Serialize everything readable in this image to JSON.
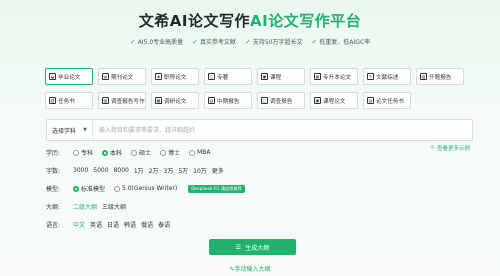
{
  "header": {
    "title_part1": "文希AI论文写作",
    "title_part2": "AI论文写作平台",
    "features": [
      "AI5.0专业高质量",
      "真实参考文献",
      "支持50万字超长文",
      "低重复、低AIGC率"
    ]
  },
  "paper_types": [
    {
      "label": "毕业论文",
      "icon": "graduation-cap-icon",
      "glyph": "◒",
      "active": true
    },
    {
      "label": "期刊论文",
      "icon": "journal-icon",
      "glyph": "▤",
      "active": false
    },
    {
      "label": "职称论文",
      "icon": "shield-icon",
      "glyph": "◈",
      "active": false
    },
    {
      "label": "专著",
      "icon": "book-icon",
      "glyph": "▯",
      "active": false
    },
    {
      "label": "课程",
      "icon": "course-icon",
      "glyph": "▣",
      "active": false
    },
    {
      "label": "专升本论文",
      "icon": "upgrade-icon",
      "glyph": "▦",
      "active": false
    },
    {
      "label": "文献综述",
      "icon": "review-icon",
      "glyph": "✎",
      "active": false
    },
    {
      "label": "开题报告",
      "icon": "report-icon",
      "glyph": "▥",
      "active": false
    },
    {
      "label": "任务书",
      "icon": "task-icon",
      "glyph": "▧",
      "active": false
    },
    {
      "label": "调查报告写作",
      "icon": "survey-icon",
      "glyph": "▨",
      "active": false
    },
    {
      "label": "调研论文",
      "icon": "research-icon",
      "glyph": "▩",
      "active": false
    },
    {
      "label": "中期报告",
      "icon": "midterm-icon",
      "glyph": "▤",
      "active": false
    },
    {
      "label": "调查报告",
      "icon": "investigation-icon",
      "glyph": "▢",
      "active": false
    },
    {
      "label": "课程论文",
      "icon": "course-paper-icon",
      "glyph": "▣",
      "active": false
    },
    {
      "label": "论文任务书",
      "icon": "paper-task-icon",
      "glyph": "▤",
      "active": false
    }
  ],
  "input": {
    "subject_select": "选择学科",
    "placeholder": "输入题目和要求等要求、越详细越好"
  },
  "tip_link": "查看更多示例",
  "options": {
    "degree": {
      "label": "学历:",
      "choices": [
        {
          "text": "专科",
          "selected": false
        },
        {
          "text": "本科",
          "selected": true
        },
        {
          "text": "硕士",
          "selected": false
        },
        {
          "text": "博士",
          "selected": false
        },
        {
          "text": "MBA",
          "selected": false
        }
      ]
    },
    "words": {
      "label": "字数:",
      "choices": [
        {
          "text": "3000",
          "selected": false
        },
        {
          "text": "5000",
          "selected": false
        },
        {
          "text": "8000",
          "selected": false
        },
        {
          "text": "1万",
          "selected": false
        },
        {
          "text": "2万",
          "selected": false
        },
        {
          "text": "3万",
          "selected": false
        },
        {
          "text": "5万",
          "selected": false
        },
        {
          "text": "10万",
          "selected": false
        },
        {
          "text": "更多",
          "selected": false
        }
      ]
    },
    "model": {
      "label": "模型:",
      "choices": [
        {
          "text": "标准模型",
          "selected": true
        },
        {
          "text": "5.0(Genius Writer)",
          "selected": false
        }
      ],
      "badge": "DeepSeek-R1 满血版推荐"
    },
    "outline": {
      "label": "大纲:",
      "choices": [
        {
          "text": "二级大纲",
          "selected": true
        },
        {
          "text": "三级大纲",
          "selected": false
        }
      ]
    },
    "language": {
      "label": "语言:",
      "choices": [
        {
          "text": "中文",
          "selected": true
        },
        {
          "text": "英语",
          "selected": false
        },
        {
          "text": "日语",
          "selected": false
        },
        {
          "text": "韩语",
          "selected": false
        },
        {
          "text": "俄语",
          "selected": false
        },
        {
          "text": "泰语",
          "selected": false
        }
      ]
    }
  },
  "generate_button": "生成大纲",
  "manual_link": "手动输入大纲",
  "colors": {
    "accent": "#20b26b"
  }
}
